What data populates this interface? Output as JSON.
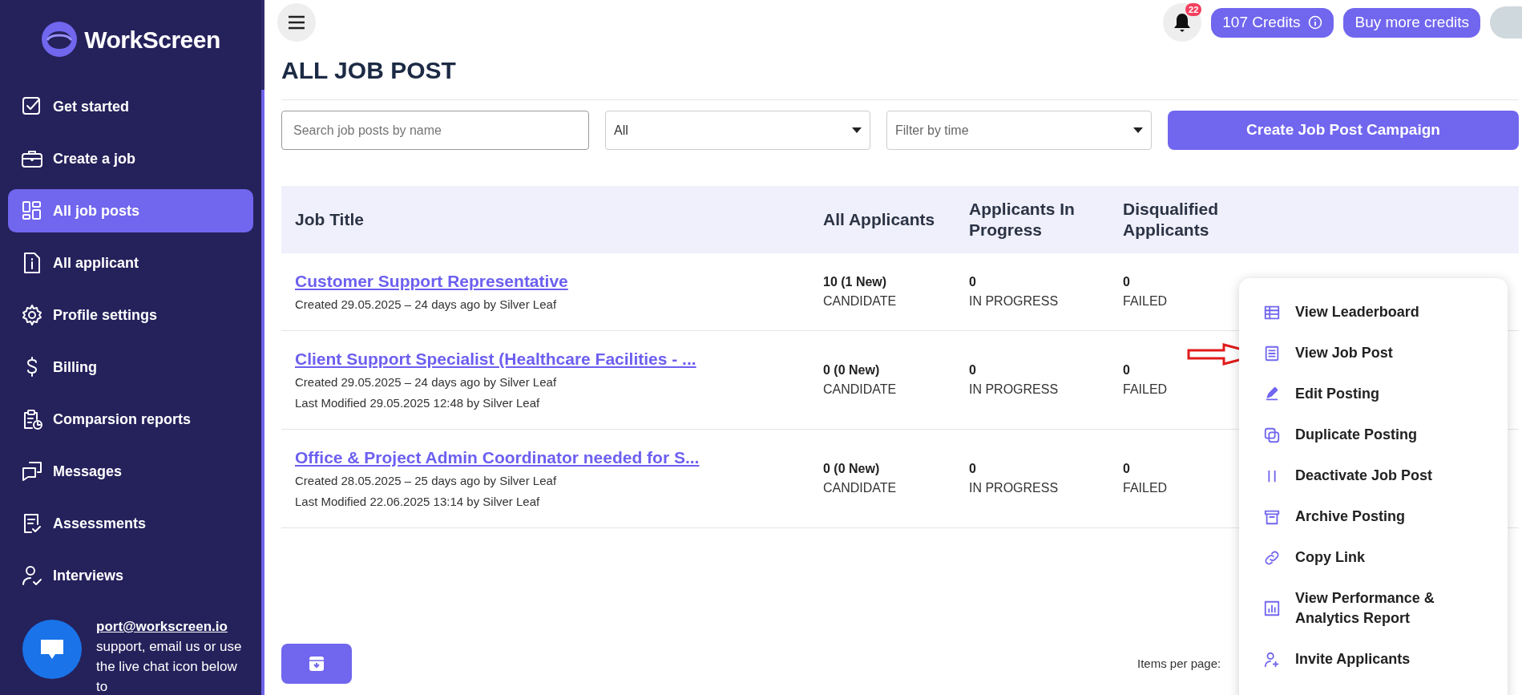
{
  "brand": {
    "logo": "WorkScreen"
  },
  "sidebar": {
    "items": [
      {
        "label": "Get started",
        "selected": false
      },
      {
        "label": "Create a job",
        "selected": false
      },
      {
        "label": "All job posts",
        "selected": true
      },
      {
        "label": "All applicant",
        "selected": false
      },
      {
        "label": "Profile settings",
        "selected": false
      },
      {
        "label": "Billing",
        "selected": false
      },
      {
        "label": "Comparsion reports",
        "selected": false
      },
      {
        "label": "Messages",
        "selected": false
      },
      {
        "label": "Assessments",
        "selected": false
      },
      {
        "label": "Interviews",
        "selected": false
      }
    ],
    "support": {
      "email": "port@workscreen.io",
      "text": "support, email us or use the live chat icon below to"
    }
  },
  "header": {
    "notification_count": "22",
    "credits": "107 Credits",
    "buy_button": "Buy more credits"
  },
  "page_title": "ALL JOB POST",
  "filters": {
    "search_placeholder": "Search job posts by name",
    "status_value": "All",
    "time_placeholder": "Filter by time",
    "create_button": "Create Job Post Campaign"
  },
  "table": {
    "columns": [
      "Job Title",
      "All Applicants",
      "Applicants In Progress",
      "Disqualified Applicants"
    ],
    "rows": [
      {
        "title": "Customer Support Representative",
        "created": "Created 29.05.2025 – 24 days ago by Silver Leaf",
        "all": "10 (1 New)",
        "all_label": "CANDIDATE",
        "in_progress": "0",
        "in_progress_label": "IN PROGRESS",
        "failed": "0",
        "failed_label": "FAILED"
      },
      {
        "title": "Client Support Specialist (Healthcare Facilities - ...",
        "created": "Created 29.05.2025 – 24 days ago by Silver Leaf",
        "modified": "Last Modified 29.05.2025 12:48 by Silver Leaf",
        "all": "0 (0 New)",
        "all_label": "CANDIDATE",
        "in_progress": "0",
        "in_progress_label": "IN PROGRESS",
        "failed": "0",
        "failed_label": "FAILED"
      },
      {
        "title": "Office & Project Admin Coordinator needed for S...",
        "created": "Created 28.05.2025 – 25 days ago by Silver Leaf",
        "modified": "Last Modified 22.06.2025 13:14 by Silver Leaf",
        "all": "0 (0 New)",
        "all_label": "CANDIDATE",
        "in_progress": "0",
        "in_progress_label": "IN PROGRESS",
        "failed": "0",
        "failed_label": "FAILED"
      }
    ]
  },
  "action_menu": {
    "items": [
      "View Leaderboard",
      "View Job Post",
      "Edit Posting",
      "Duplicate Posting",
      "Deactivate Job Post",
      "Archive Posting",
      "Copy Link",
      "View Performance & Analytics Report",
      "Invite Applicants"
    ]
  },
  "footer": {
    "items_per_page": "Items per page:"
  }
}
